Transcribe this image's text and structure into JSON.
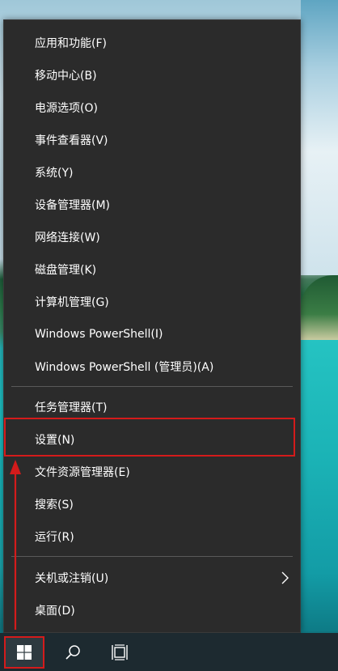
{
  "menu": {
    "items": [
      {
        "label": "应用和功能(F)"
      },
      {
        "label": "移动中心(B)"
      },
      {
        "label": "电源选项(O)"
      },
      {
        "label": "事件查看器(V)"
      },
      {
        "label": "系统(Y)"
      },
      {
        "label": "设备管理器(M)"
      },
      {
        "label": "网络连接(W)"
      },
      {
        "label": "磁盘管理(K)"
      },
      {
        "label": "计算机管理(G)"
      },
      {
        "label": "Windows PowerShell(I)"
      },
      {
        "label": "Windows PowerShell (管理员)(A)"
      },
      {
        "label": "任务管理器(T)"
      },
      {
        "label": "设置(N)"
      },
      {
        "label": "文件资源管理器(E)"
      },
      {
        "label": "搜索(S)"
      },
      {
        "label": "运行(R)"
      },
      {
        "label": "关机或注销(U)"
      },
      {
        "label": "桌面(D)"
      }
    ]
  },
  "taskbar": {
    "icons": [
      "windows-start-icon",
      "search-icon",
      "task-view-icon"
    ]
  },
  "colors": {
    "menu_bg": "#2b2b2b",
    "menu_text": "#ffffff",
    "annotation_red": "#d41b1b",
    "taskbar_bg": "#1d2a30"
  }
}
